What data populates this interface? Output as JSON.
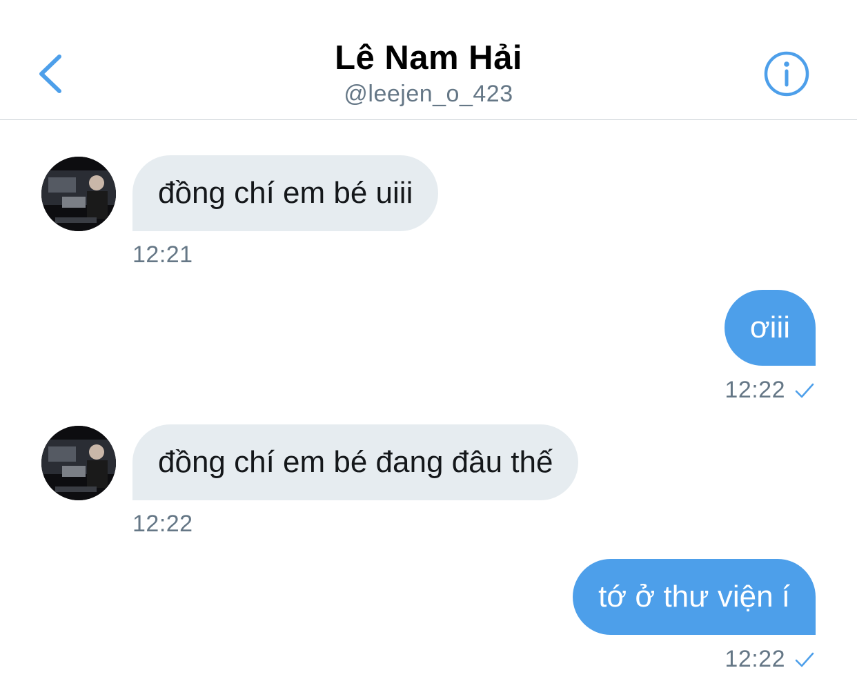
{
  "header": {
    "title": "Lê Nam Hải",
    "handle": "@leejen_o_423",
    "back_icon": "chevron-left-icon",
    "info_icon": "info-circle-icon",
    "accent": "#4d9fea"
  },
  "messages": [
    {
      "direction": "incoming",
      "text": "đồng chí em bé uiii",
      "time": "12:21"
    },
    {
      "direction": "outgoing",
      "text": "ơiii",
      "time": "12:22",
      "status_icon": "check-icon"
    },
    {
      "direction": "incoming",
      "text": "đồng chí em bé đang đâu thế",
      "time": "12:22"
    },
    {
      "direction": "outgoing",
      "text": "tớ ở thư viện í",
      "time": "12:22",
      "status_icon": "check-icon"
    }
  ],
  "colors": {
    "incoming_bubble": "#e6ecf0",
    "outgoing_bubble": "#4d9fea",
    "timestamp": "#657786"
  }
}
